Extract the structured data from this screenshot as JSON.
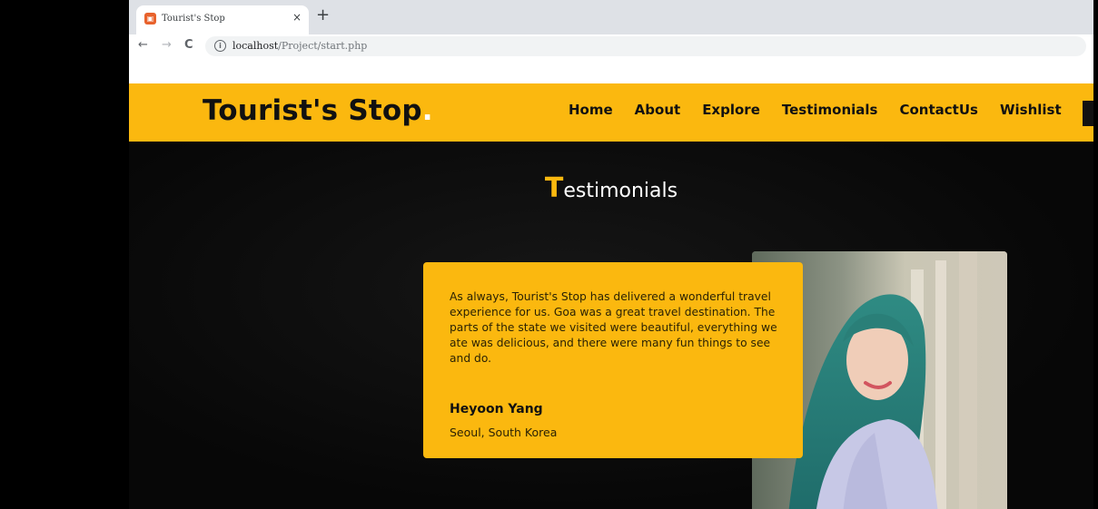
{
  "browser": {
    "tab_title": "Tourist's Stop",
    "tab_close": "×",
    "new_tab": "+",
    "back": "←",
    "forward": "→",
    "reload": "C",
    "url_host": "localhost",
    "url_path": "/Project/start.php"
  },
  "header": {
    "logo_text": "Tourist's Stop",
    "logo_dot": ".",
    "nav": [
      {
        "label": "Home"
      },
      {
        "label": "About"
      },
      {
        "label": "Explore"
      },
      {
        "label": "Testimonials"
      },
      {
        "label": "ContactUs"
      },
      {
        "label": "Wishlist"
      }
    ]
  },
  "section": {
    "title_first_letter": "T",
    "title_rest": "estimonials"
  },
  "testimonial": {
    "quote": "As always, Tourist's Stop has delivered a wonderful travel experience for us. Goa was a great travel destination. The parts of the state we visited were beautiful, everything we ate was delicious, and there were many fun things to see and do.",
    "name": "Heyoon Yang",
    "location": "Seoul, South Korea"
  },
  "colors": {
    "accent": "#fbb80f",
    "background": "#0b0b0b",
    "text_dark": "#111111"
  }
}
